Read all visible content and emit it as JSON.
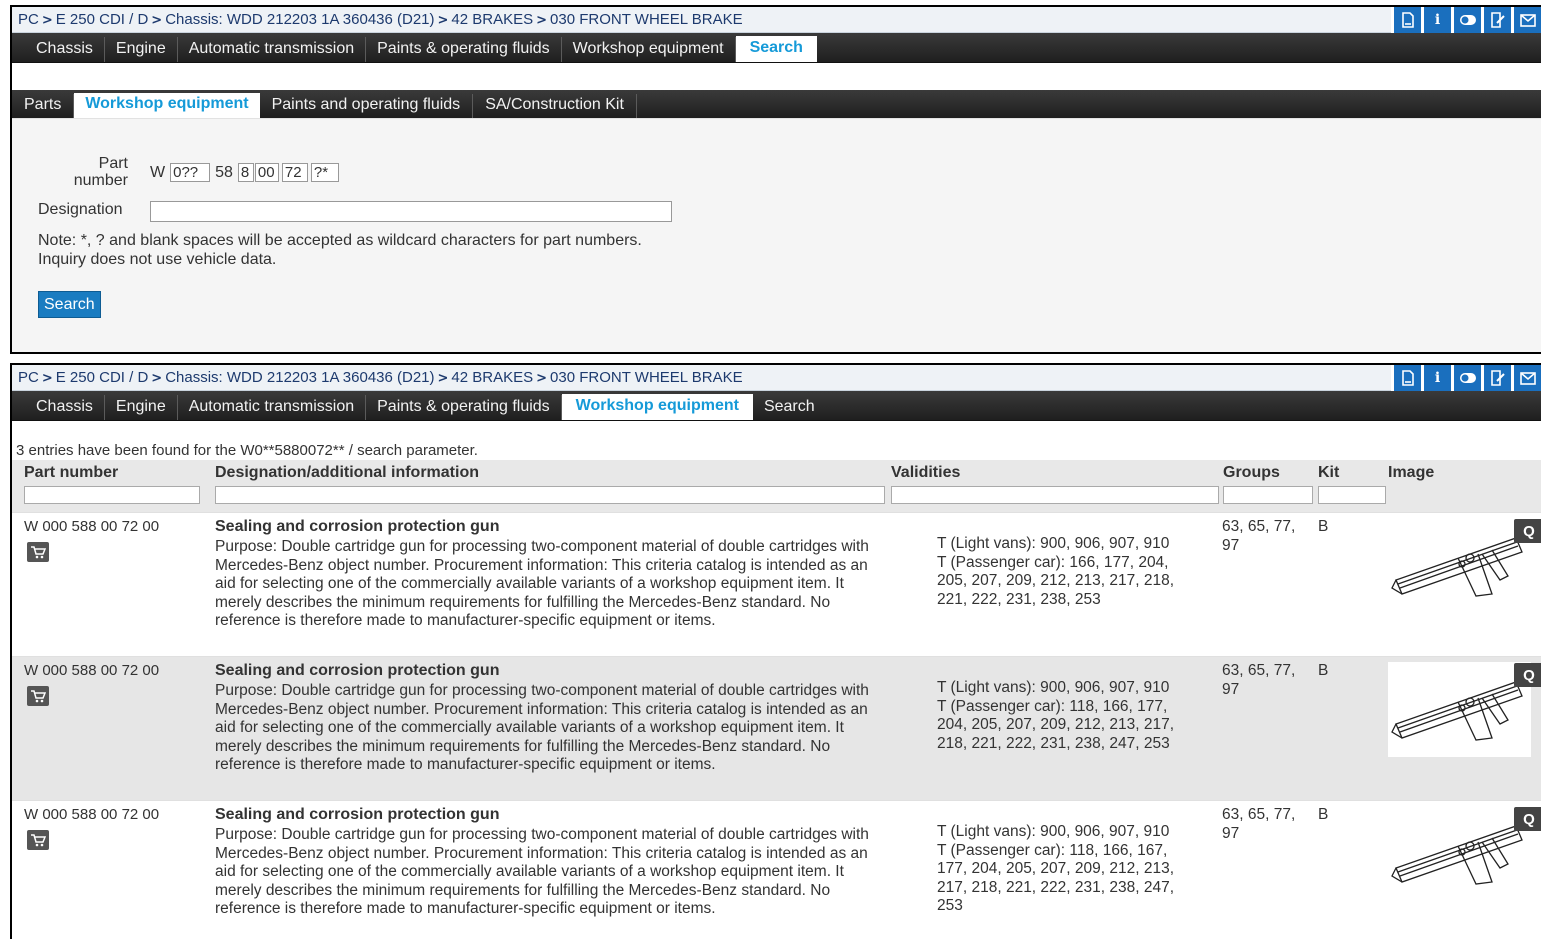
{
  "breadcrumb": [
    "PC",
    "E 250 CDI / D",
    "Chassis: WDD 212203 1A 360436 (D21)",
    "42 BRAKES",
    "030 FRONT WHEEL BRAKE"
  ],
  "toolbar_icons": [
    "print-icon",
    "info-icon",
    "toggle-icon",
    "edit-note-icon",
    "mail-icon"
  ],
  "info_glyph": "i",
  "top_tabs": [
    "Chassis",
    "Engine",
    "Automatic transmission",
    "Paints & operating fluids",
    "Workshop equipment",
    "Search"
  ],
  "panel1": {
    "active_top_tab": "Search",
    "sub_tabs": [
      "Parts",
      "Workshop equipment",
      "Paints and operating fluids",
      "SA/Construction Kit"
    ],
    "active_sub_tab": "Workshop equipment",
    "part_number_label": "Part number",
    "part_prefix": "W",
    "part_fields": [
      "0??",
      "58",
      "8",
      "00",
      "72",
      "?*"
    ],
    "designation_label": "Designation",
    "designation_value": "",
    "note_line1": "Note: *, ? and blank spaces will be accepted as wildcard characters for part numbers.",
    "note_line2": "Inquiry does not use vehicle data.",
    "search_button": "Search"
  },
  "panel2": {
    "active_top_tab": "Workshop equipment",
    "result_message": "3 entries have been found for the W0**5880072** / search parameter.",
    "columns": [
      "Part number",
      "Designation/additional information",
      "Validities",
      "Groups",
      "Kit",
      "Image"
    ],
    "zoom_glyph": "Q",
    "rows": [
      {
        "part_number": "W 000 588 00 72 00",
        "title": "Sealing and corrosion protection gun",
        "description": "Purpose: Double cartridge gun for processing two-component material of double cartridges with Mercedes-Benz object number. Procurement information: This criteria catalog is intended as an aid for selecting one of the commercially available variants of a workshop equipment item. It merely describes the minimum requirements for fulfilling the Mercedes-Benz standard. No reference is therefore made to manufacturer-specific equipment or items.",
        "validity_1": "T (Light vans): 900, 906, 907, 910",
        "validity_2": "T (Passenger car): 166, 177, 204, 205, 207, 209, 212, 213, 217, 218, 221, 222, 231, 238, 253",
        "groups": "63, 65, 77, 97",
        "kit": "B"
      },
      {
        "part_number": "W 000 588 00 72 00",
        "title": "Sealing and corrosion protection gun",
        "description": "Purpose: Double cartridge gun for processing two-component material of double cartridges with Mercedes-Benz object number. Procurement information: This criteria catalog is intended as an aid for selecting one of the commercially available variants of a workshop equipment item. It merely describes the minimum requirements for fulfilling the Mercedes-Benz standard. No reference is therefore made to manufacturer-specific equipment or items.",
        "validity_1": "T (Light vans): 900, 906, 907, 910",
        "validity_2": "T (Passenger car): 118, 166, 177, 204, 205, 207, 209, 212, 213, 217, 218, 221, 222, 231, 238, 247, 253",
        "groups": "63, 65, 77, 97",
        "kit": "B"
      },
      {
        "part_number": "W 000 588 00 72 00",
        "title": "Sealing and corrosion protection gun",
        "description": "Purpose: Double cartridge gun for processing two-component material of double cartridges with Mercedes-Benz object number. Procurement information: This criteria catalog is intended as an aid for selecting one of the commercially available variants of a workshop equipment item. It merely describes the minimum requirements for fulfilling the Mercedes-Benz standard. No reference is therefore made to manufacturer-specific equipment or items.",
        "validity_1": "T (Light vans): 900, 906, 907, 910",
        "validity_2": "T (Passenger car): 118, 166, 167, 177, 204, 205, 207, 209, 212, 213, 217, 218, 221, 222, 231, 238, 247, 253",
        "groups": "63, 65, 77, 97",
        "kit": "B"
      }
    ]
  },
  "colors": {
    "accent": "#159ad8",
    "nav_bg": "#2b2b2b",
    "icon_bg": "#1a6fbe",
    "button_bg": "#1a7cc1",
    "row_alt": "#e6e6e6"
  }
}
